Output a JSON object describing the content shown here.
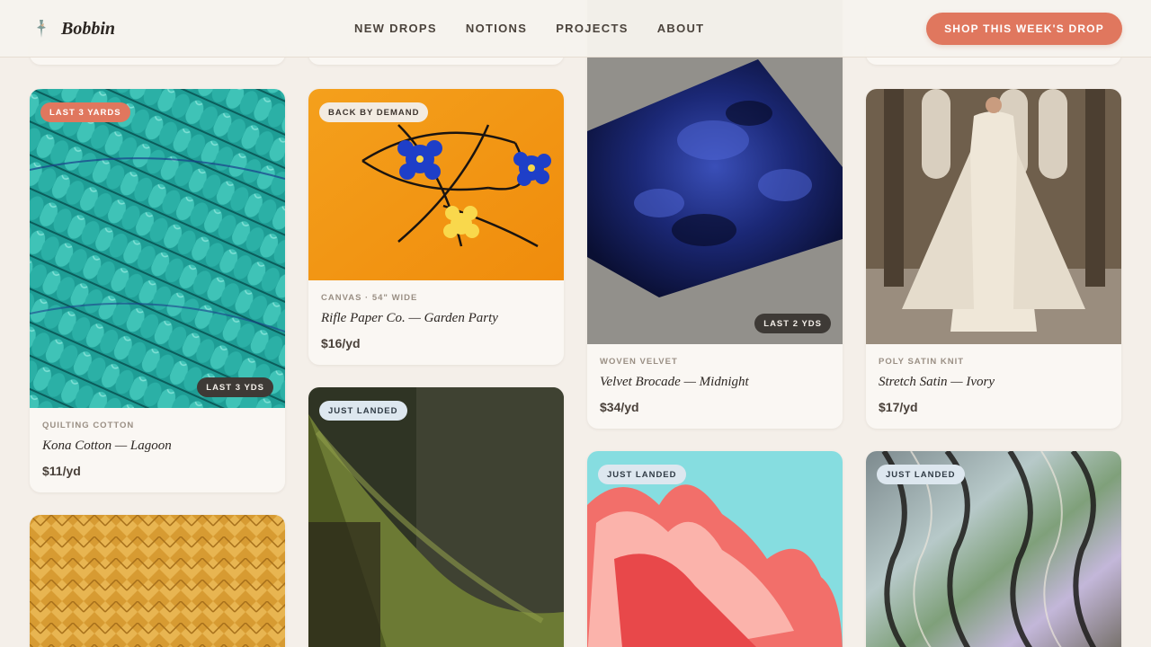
{
  "header": {
    "brand": "Bobbin",
    "nav": [
      "NEW DROPS",
      "NOTIONS",
      "PROJECTS",
      "ABOUT"
    ],
    "cta_label": "SHOP THIS WEEK'S DROP"
  },
  "colors": {
    "accent": "#e0775e",
    "background": "#f4efe9",
    "card": "#faf7f3"
  },
  "products": [
    {
      "badge": "LAST 3 YARDS",
      "stock_badge": "LAST 3 YDS",
      "meta": "QUILTING COTTON",
      "title": "Kona Cotton — Lagoon",
      "price": "$11/yd",
      "image": "teal-rope-yarn"
    },
    {
      "badge": "BACK BY DEMAND",
      "meta": "CANVAS · 54\" WIDE",
      "title": "Rifle Paper Co. — Garden Party",
      "price": "$16/yd",
      "image": "orange-floral-canvas"
    },
    {
      "stock_badge": "LAST 2 YDS",
      "meta": "WOVEN VELVET",
      "title": "Velvet Brocade — Midnight",
      "price": "$34/yd",
      "image": "navy-velvet-swatch"
    },
    {
      "meta": "POLY SATIN KNIT",
      "title": "Stretch Satin — Ivory",
      "price": "$17/yd",
      "image": "ivory-satin-gown"
    },
    {
      "image": "woven-rattan"
    },
    {
      "badge": "JUST LANDED",
      "image": "olive-draped-fabric"
    },
    {
      "badge": "JUST LANDED",
      "image": "coral-ruffle"
    },
    {
      "badge": "JUST LANDED",
      "image": "holographic-marble"
    }
  ]
}
